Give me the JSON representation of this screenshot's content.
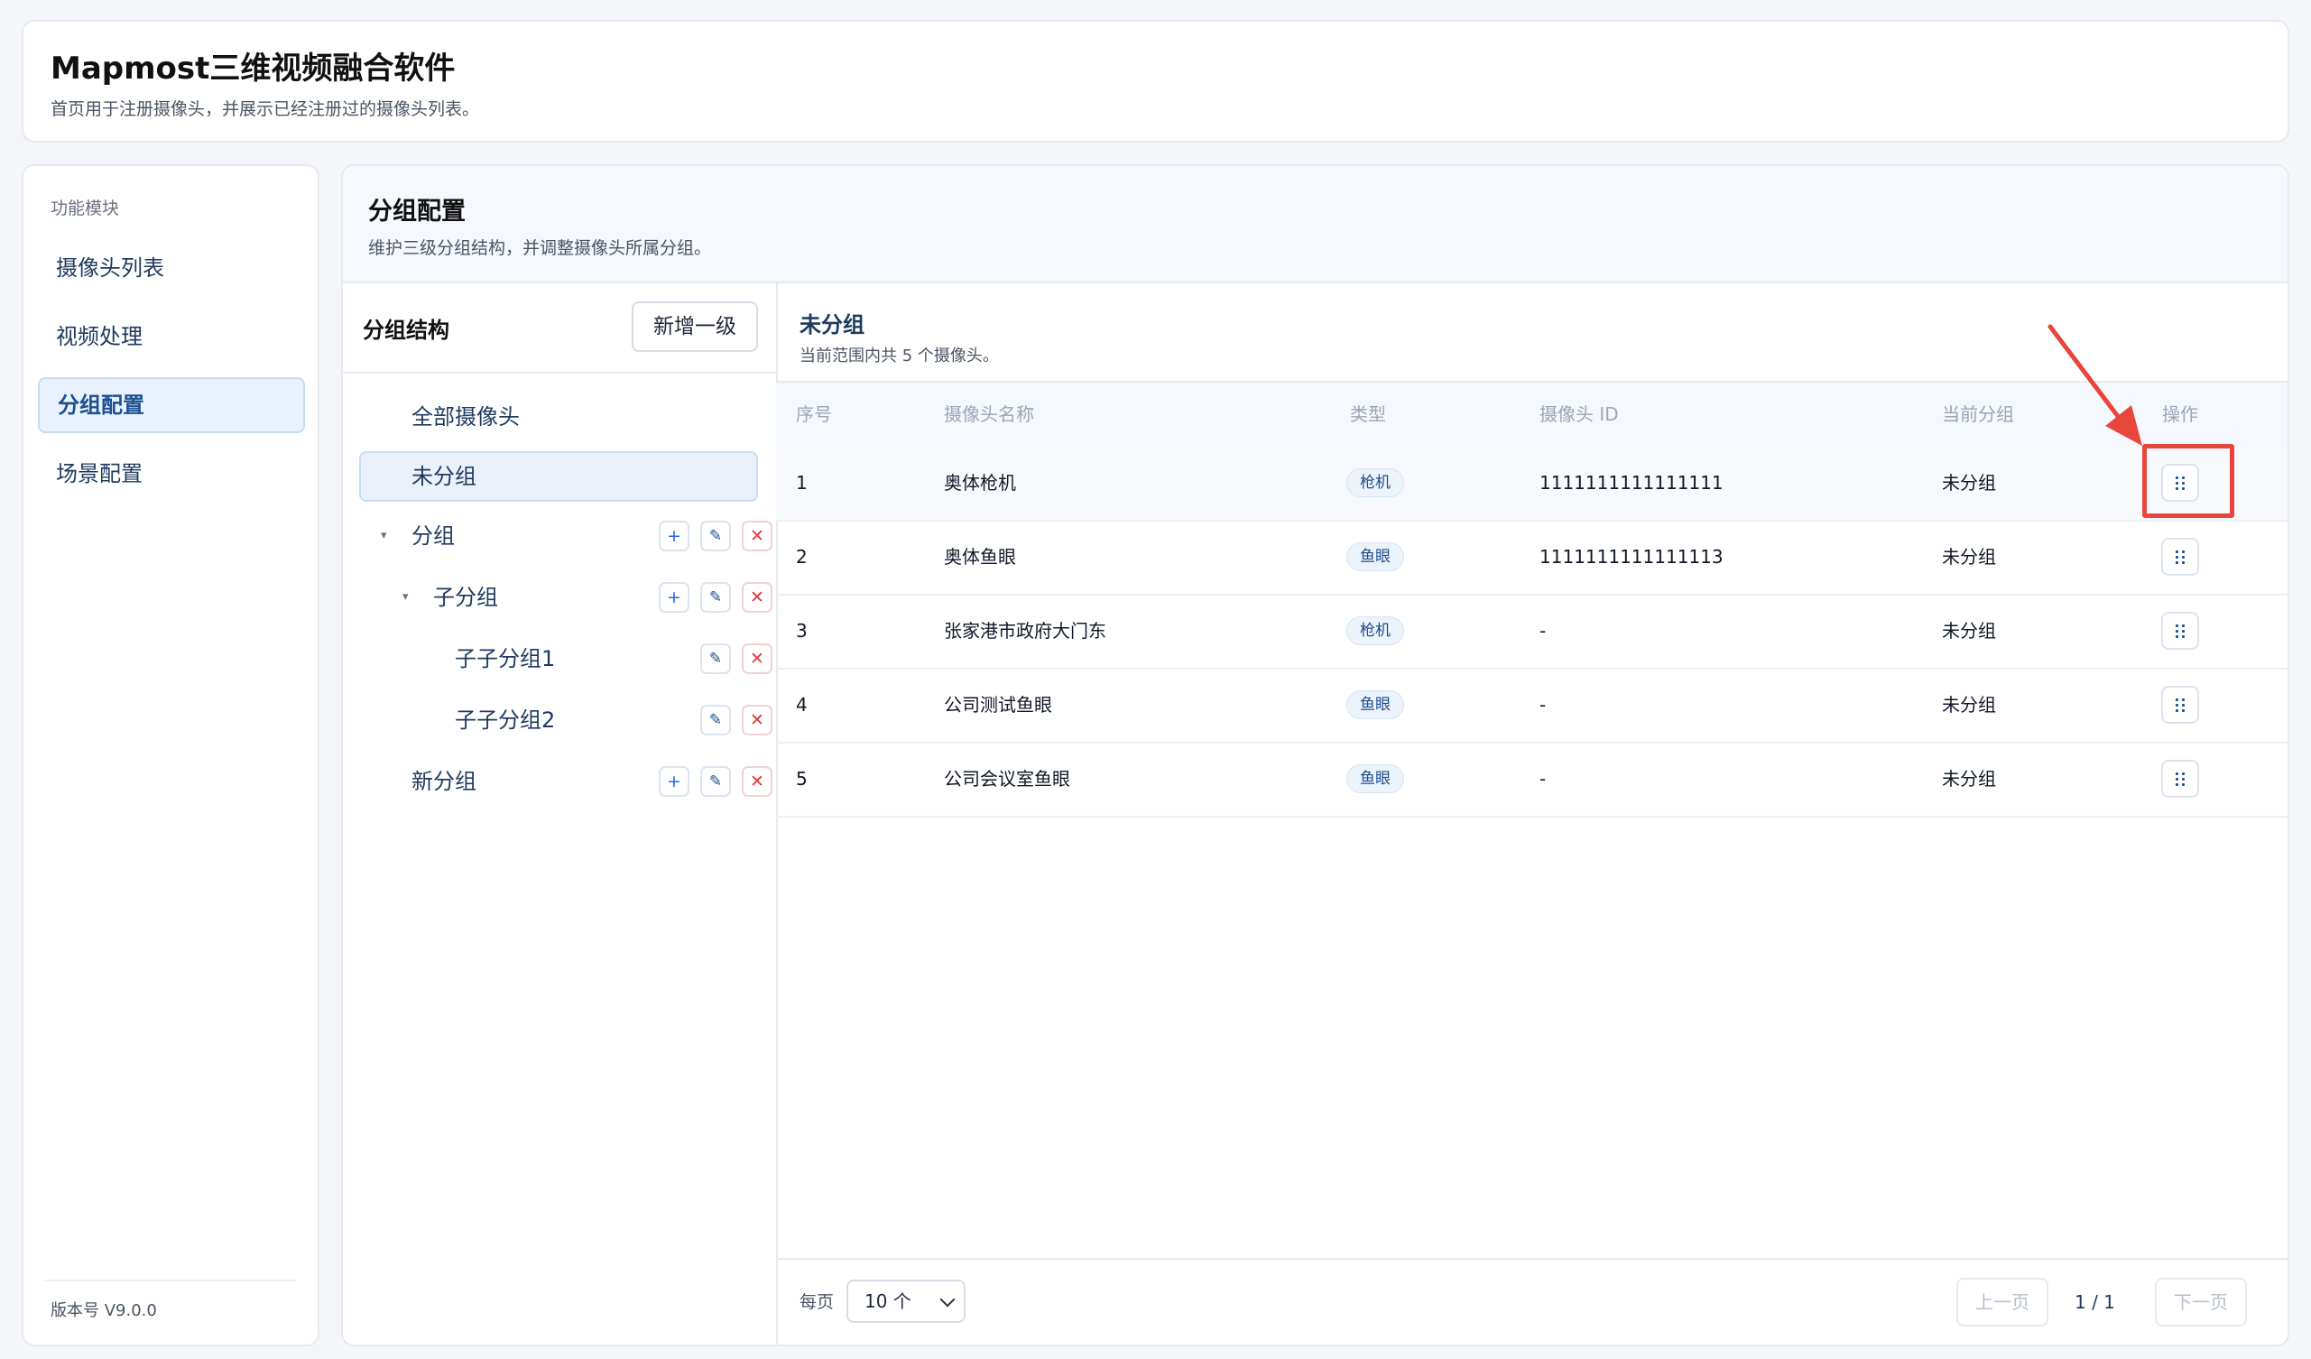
{
  "header": {
    "title": "Mapmost三维视频融合软件",
    "subtitle": "首页用于注册摄像头，并展示已经注册过的摄像头列表。"
  },
  "sidebar": {
    "section_label": "功能模块",
    "items": [
      {
        "label": "摄像头列表",
        "active": false
      },
      {
        "label": "视频处理",
        "active": false
      },
      {
        "label": "分组配置",
        "active": true
      },
      {
        "label": "场景配置",
        "active": false
      }
    ],
    "version": "版本号 V9.0.0"
  },
  "main": {
    "title": "分组配置",
    "subtitle": "维护三级分组结构，并调整摄像头所属分组。"
  },
  "tree": {
    "title": "分组结构",
    "add_level_label": "新增一级",
    "nodes": [
      {
        "label": "全部摄像头"
      },
      {
        "label": "未分组",
        "selected": true
      },
      {
        "label": "分组",
        "expanded": true
      },
      {
        "label": "子分组",
        "expanded": true
      },
      {
        "label": "子子分组1"
      },
      {
        "label": "子子分组2"
      },
      {
        "label": "新分组"
      }
    ],
    "icons": {
      "add": "plus-icon",
      "edit": "pencil-icon",
      "delete": "close-icon",
      "caret": "caret-down-icon"
    },
    "glyphs": {
      "add": "+",
      "edit": "✎",
      "delete": "✕",
      "caret": "▾"
    }
  },
  "list": {
    "title": "未分组",
    "subtitle": "当前范围内共 5 个摄像头。",
    "columns": [
      "序号",
      "摄像头名称",
      "类型",
      "摄像头 ID",
      "当前分组",
      "操作"
    ],
    "rows": [
      {
        "index": "1",
        "name": "奥体枪机",
        "type": "枪机",
        "id": "1111111111111111",
        "group": "未分组"
      },
      {
        "index": "2",
        "name": "奥体鱼眼",
        "type": "鱼眼",
        "id": "1111111111111113",
        "group": "未分组"
      },
      {
        "index": "3",
        "name": "张家港市政府大门东",
        "type": "枪机",
        "id": "-",
        "group": "未分组"
      },
      {
        "index": "4",
        "name": "公司测试鱼眼",
        "type": "鱼眼",
        "id": "-",
        "group": "未分组"
      },
      {
        "index": "5",
        "name": "公司会议室鱼眼",
        "type": "鱼眼",
        "id": "-",
        "group": "未分组"
      }
    ],
    "row_action_icon": "drag-handle-icon"
  },
  "pager": {
    "per_page_label": "每页",
    "per_page_value": "10 个",
    "prev_label": "上一页",
    "page_info": "1 / 1",
    "next_label": "下一页"
  },
  "colors": {
    "accent": "#1d4f91",
    "annotation": "#e8453c",
    "danger": "#e0393e"
  }
}
